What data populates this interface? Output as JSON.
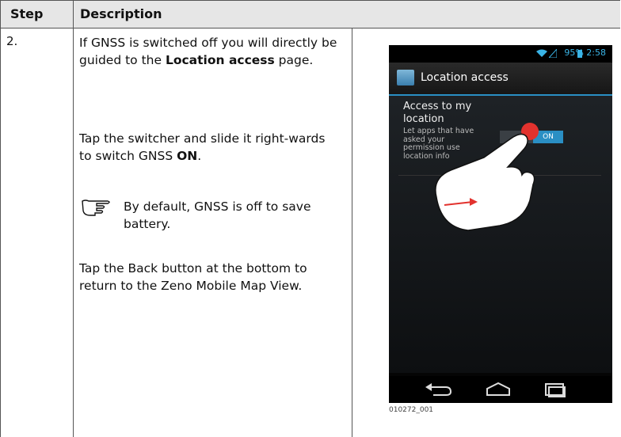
{
  "table": {
    "header_step": "Step",
    "header_description": "Description"
  },
  "row": {
    "step": "2.",
    "p1_pre": "If GNSS is switched off you will directly be guided to the ",
    "p1_bold": "Location access",
    "p1_post": " page.",
    "p2_pre": "Tap the switcher and slide it right-wards to switch GNSS ",
    "p2_bold": "ON",
    "p2_post": ".",
    "note": "By default, GNSS is off to save battery.",
    "p3": "Tap the Back button at the bottom to return to the Zeno Mobile Map View."
  },
  "phone": {
    "status_text": "95% 2:58",
    "title": "Location access",
    "setting_title": "Access to my location",
    "setting_sub": "Let apps that have asked your permission use location info",
    "toggle_label": "ON",
    "icons": [
      "wifi-icon",
      "signal-icon",
      "battery-icon",
      "back-icon",
      "home-icon",
      "recents-icon",
      "pointing-hand-icon"
    ],
    "accent": "#2a8fc4"
  },
  "caption": "010272_001"
}
